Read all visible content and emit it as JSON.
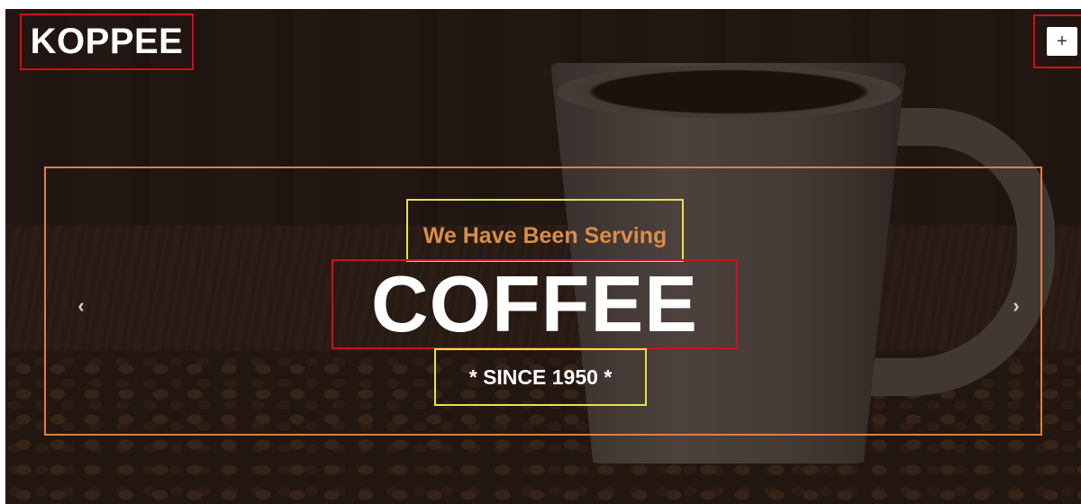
{
  "brand": {
    "name": "KOPPEE"
  },
  "navbar": {
    "toggle_icon": "plus-icon",
    "toggle_label": "+"
  },
  "carousel": {
    "subtitle": "We Have Been Serving",
    "title": "COFFEE",
    "tagline": "* SINCE 1950 *",
    "prev_icon": "chevron-left-icon",
    "prev_label": "‹",
    "next_icon": "chevron-right-icon",
    "next_label": "›"
  },
  "colors": {
    "subtitle": "#d98e4a",
    "title": "#ffffff",
    "background": "#2c2019",
    "highlight_red": "#d0101a",
    "highlight_orange": "#e27f3c",
    "highlight_yellow": "#e8e24a"
  }
}
